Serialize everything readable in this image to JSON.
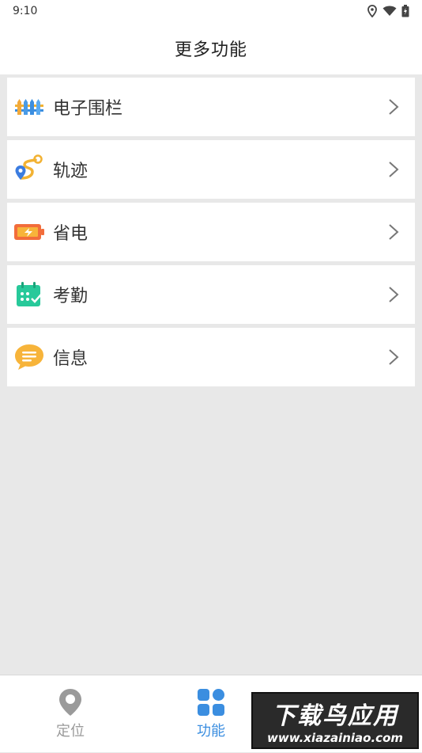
{
  "status_bar": {
    "time": "9:10"
  },
  "header": {
    "title": "更多功能"
  },
  "menu": {
    "items": [
      {
        "label": "电子围栏",
        "icon": "fence-icon"
      },
      {
        "label": "轨迹",
        "icon": "route-icon"
      },
      {
        "label": "省电",
        "icon": "battery-icon"
      },
      {
        "label": "考勤",
        "icon": "calendar-check-icon"
      },
      {
        "label": "信息",
        "icon": "message-icon"
      }
    ]
  },
  "tabbar": {
    "tabs": [
      {
        "label": "定位",
        "icon": "location-pin-icon",
        "active": false
      },
      {
        "label": "功能",
        "icon": "grid-icon",
        "active": true
      }
    ]
  },
  "watermark": {
    "title": "下载鸟应用",
    "url": "www.xiazainiao.com"
  },
  "colors": {
    "accent": "#3b8ee0",
    "inactive": "#9a9a9a",
    "background": "#e8e8e8"
  }
}
